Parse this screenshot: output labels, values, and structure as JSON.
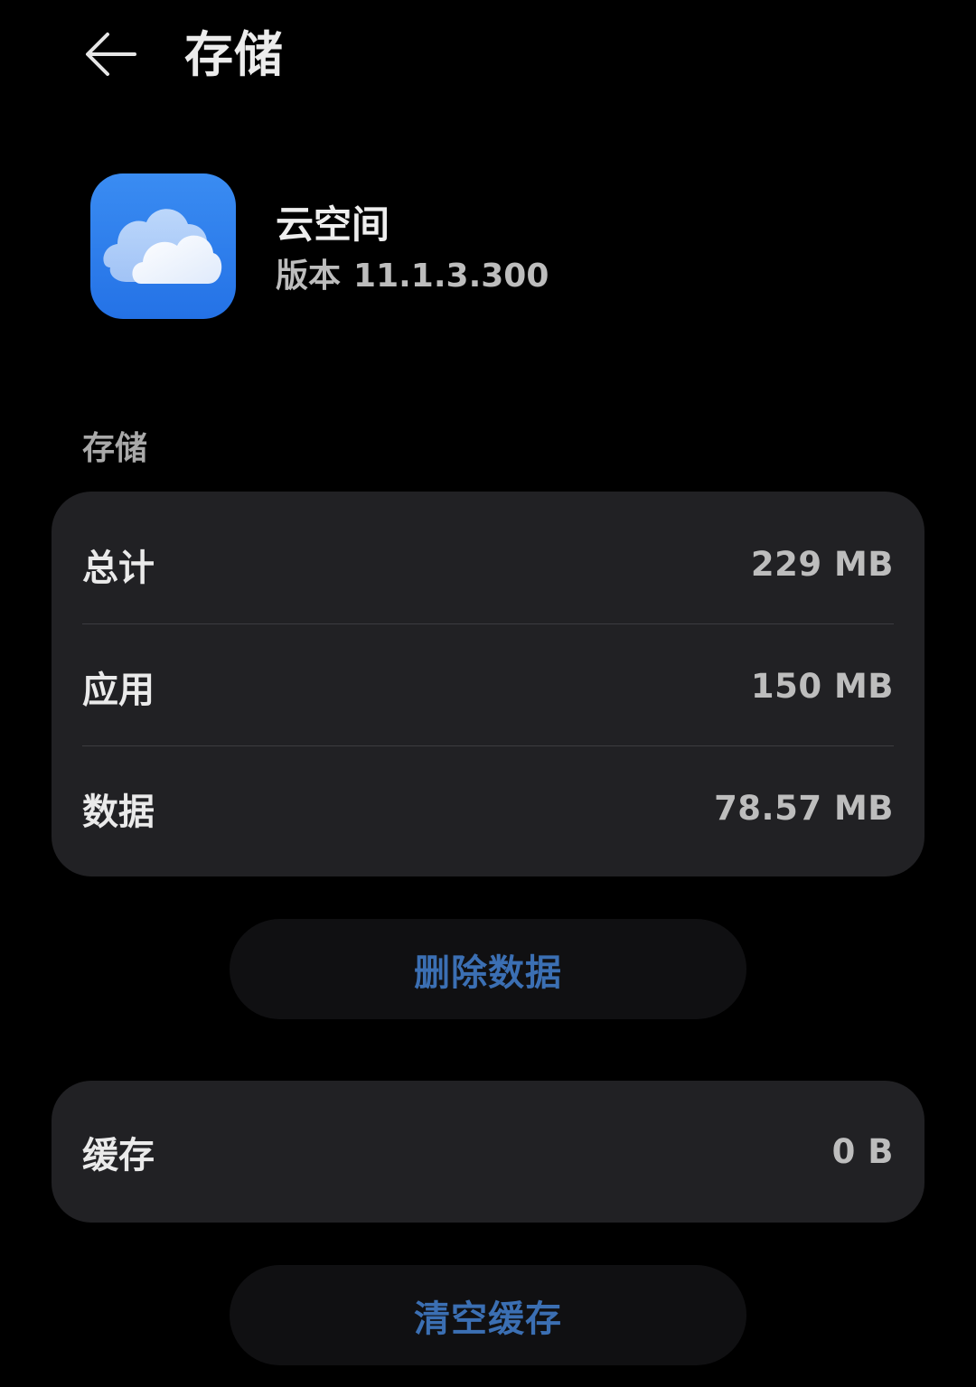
{
  "header": {
    "title": "存储",
    "back_icon": "arrow-left-icon"
  },
  "app": {
    "name": "云空间",
    "version_label": "版本",
    "version_value": "11.1.3.300",
    "icon": "cloud-icon",
    "icon_color": "#2f80ed"
  },
  "storage": {
    "section_label": "存储",
    "rows": [
      {
        "label": "总计",
        "value": "229 MB"
      },
      {
        "label": "应用",
        "value": "150 MB"
      },
      {
        "label": "数据",
        "value": "78.57 MB"
      }
    ]
  },
  "actions": {
    "delete_data": "删除数据",
    "clear_cache": "清空缓存",
    "accent_color": "#3b6fb3"
  },
  "cache": {
    "label": "缓存",
    "value": "0 B"
  }
}
